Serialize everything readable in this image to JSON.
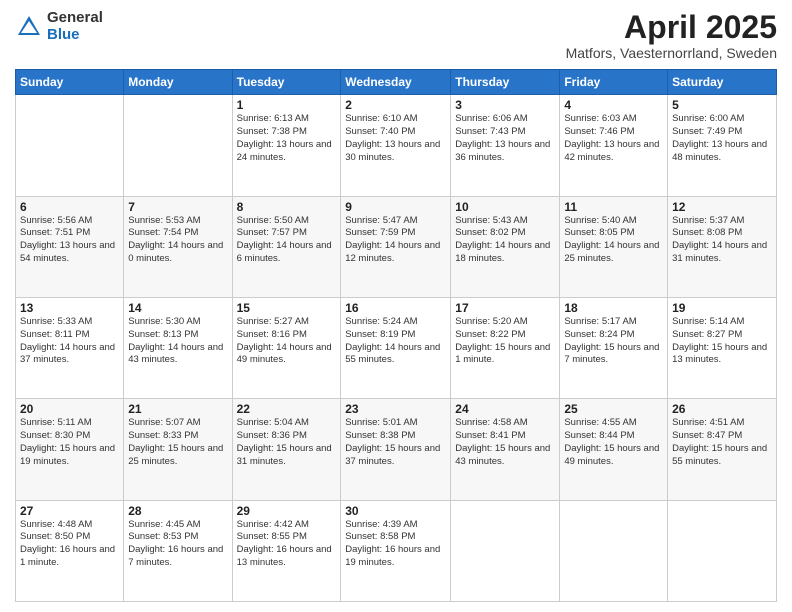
{
  "header": {
    "logo_general": "General",
    "logo_blue": "Blue",
    "title": "April 2025",
    "subtitle": "Matfors, Vaesternorrland, Sweden"
  },
  "weekdays": [
    "Sunday",
    "Monday",
    "Tuesday",
    "Wednesday",
    "Thursday",
    "Friday",
    "Saturday"
  ],
  "weeks": [
    [
      null,
      null,
      {
        "day": 1,
        "sunrise": "Sunrise: 6:13 AM",
        "sunset": "Sunset: 7:38 PM",
        "daylight": "Daylight: 13 hours and 24 minutes."
      },
      {
        "day": 2,
        "sunrise": "Sunrise: 6:10 AM",
        "sunset": "Sunset: 7:40 PM",
        "daylight": "Daylight: 13 hours and 30 minutes."
      },
      {
        "day": 3,
        "sunrise": "Sunrise: 6:06 AM",
        "sunset": "Sunset: 7:43 PM",
        "daylight": "Daylight: 13 hours and 36 minutes."
      },
      {
        "day": 4,
        "sunrise": "Sunrise: 6:03 AM",
        "sunset": "Sunset: 7:46 PM",
        "daylight": "Daylight: 13 hours and 42 minutes."
      },
      {
        "day": 5,
        "sunrise": "Sunrise: 6:00 AM",
        "sunset": "Sunset: 7:49 PM",
        "daylight": "Daylight: 13 hours and 48 minutes."
      }
    ],
    [
      {
        "day": 6,
        "sunrise": "Sunrise: 5:56 AM",
        "sunset": "Sunset: 7:51 PM",
        "daylight": "Daylight: 13 hours and 54 minutes."
      },
      {
        "day": 7,
        "sunrise": "Sunrise: 5:53 AM",
        "sunset": "Sunset: 7:54 PM",
        "daylight": "Daylight: 14 hours and 0 minutes."
      },
      {
        "day": 8,
        "sunrise": "Sunrise: 5:50 AM",
        "sunset": "Sunset: 7:57 PM",
        "daylight": "Daylight: 14 hours and 6 minutes."
      },
      {
        "day": 9,
        "sunrise": "Sunrise: 5:47 AM",
        "sunset": "Sunset: 7:59 PM",
        "daylight": "Daylight: 14 hours and 12 minutes."
      },
      {
        "day": 10,
        "sunrise": "Sunrise: 5:43 AM",
        "sunset": "Sunset: 8:02 PM",
        "daylight": "Daylight: 14 hours and 18 minutes."
      },
      {
        "day": 11,
        "sunrise": "Sunrise: 5:40 AM",
        "sunset": "Sunset: 8:05 PM",
        "daylight": "Daylight: 14 hours and 25 minutes."
      },
      {
        "day": 12,
        "sunrise": "Sunrise: 5:37 AM",
        "sunset": "Sunset: 8:08 PM",
        "daylight": "Daylight: 14 hours and 31 minutes."
      }
    ],
    [
      {
        "day": 13,
        "sunrise": "Sunrise: 5:33 AM",
        "sunset": "Sunset: 8:11 PM",
        "daylight": "Daylight: 14 hours and 37 minutes."
      },
      {
        "day": 14,
        "sunrise": "Sunrise: 5:30 AM",
        "sunset": "Sunset: 8:13 PM",
        "daylight": "Daylight: 14 hours and 43 minutes."
      },
      {
        "day": 15,
        "sunrise": "Sunrise: 5:27 AM",
        "sunset": "Sunset: 8:16 PM",
        "daylight": "Daylight: 14 hours and 49 minutes."
      },
      {
        "day": 16,
        "sunrise": "Sunrise: 5:24 AM",
        "sunset": "Sunset: 8:19 PM",
        "daylight": "Daylight: 14 hours and 55 minutes."
      },
      {
        "day": 17,
        "sunrise": "Sunrise: 5:20 AM",
        "sunset": "Sunset: 8:22 PM",
        "daylight": "Daylight: 15 hours and 1 minute."
      },
      {
        "day": 18,
        "sunrise": "Sunrise: 5:17 AM",
        "sunset": "Sunset: 8:24 PM",
        "daylight": "Daylight: 15 hours and 7 minutes."
      },
      {
        "day": 19,
        "sunrise": "Sunrise: 5:14 AM",
        "sunset": "Sunset: 8:27 PM",
        "daylight": "Daylight: 15 hours and 13 minutes."
      }
    ],
    [
      {
        "day": 20,
        "sunrise": "Sunrise: 5:11 AM",
        "sunset": "Sunset: 8:30 PM",
        "daylight": "Daylight: 15 hours and 19 minutes."
      },
      {
        "day": 21,
        "sunrise": "Sunrise: 5:07 AM",
        "sunset": "Sunset: 8:33 PM",
        "daylight": "Daylight: 15 hours and 25 minutes."
      },
      {
        "day": 22,
        "sunrise": "Sunrise: 5:04 AM",
        "sunset": "Sunset: 8:36 PM",
        "daylight": "Daylight: 15 hours and 31 minutes."
      },
      {
        "day": 23,
        "sunrise": "Sunrise: 5:01 AM",
        "sunset": "Sunset: 8:38 PM",
        "daylight": "Daylight: 15 hours and 37 minutes."
      },
      {
        "day": 24,
        "sunrise": "Sunrise: 4:58 AM",
        "sunset": "Sunset: 8:41 PM",
        "daylight": "Daylight: 15 hours and 43 minutes."
      },
      {
        "day": 25,
        "sunrise": "Sunrise: 4:55 AM",
        "sunset": "Sunset: 8:44 PM",
        "daylight": "Daylight: 15 hours and 49 minutes."
      },
      {
        "day": 26,
        "sunrise": "Sunrise: 4:51 AM",
        "sunset": "Sunset: 8:47 PM",
        "daylight": "Daylight: 15 hours and 55 minutes."
      }
    ],
    [
      {
        "day": 27,
        "sunrise": "Sunrise: 4:48 AM",
        "sunset": "Sunset: 8:50 PM",
        "daylight": "Daylight: 16 hours and 1 minute."
      },
      {
        "day": 28,
        "sunrise": "Sunrise: 4:45 AM",
        "sunset": "Sunset: 8:53 PM",
        "daylight": "Daylight: 16 hours and 7 minutes."
      },
      {
        "day": 29,
        "sunrise": "Sunrise: 4:42 AM",
        "sunset": "Sunset: 8:55 PM",
        "daylight": "Daylight: 16 hours and 13 minutes."
      },
      {
        "day": 30,
        "sunrise": "Sunrise: 4:39 AM",
        "sunset": "Sunset: 8:58 PM",
        "daylight": "Daylight: 16 hours and 19 minutes."
      },
      null,
      null,
      null
    ]
  ]
}
